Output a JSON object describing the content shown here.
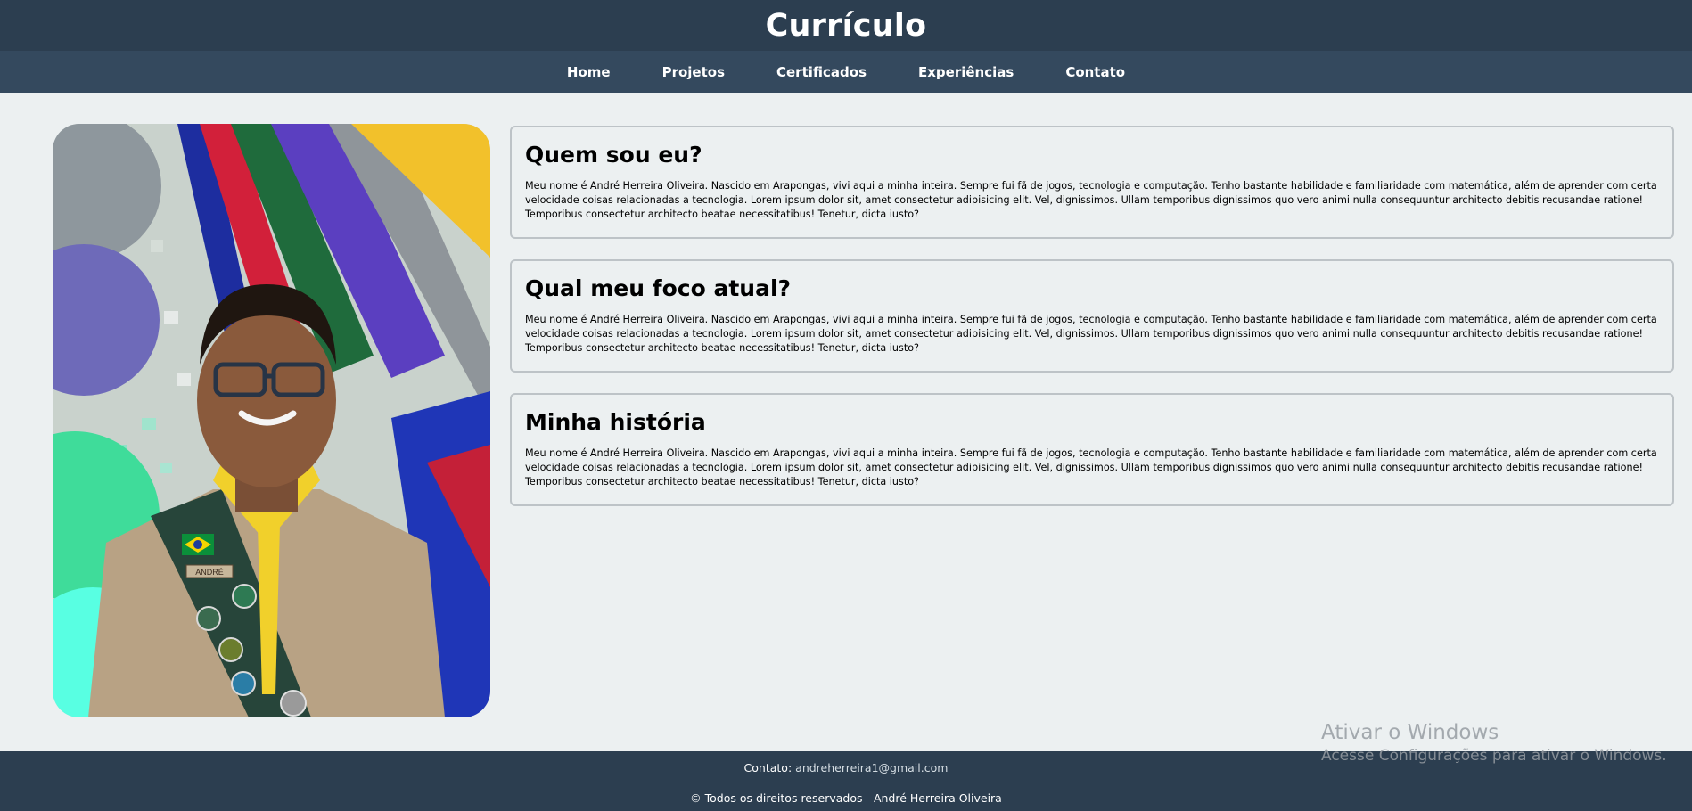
{
  "header": {
    "title": "Currículo"
  },
  "nav": {
    "items": [
      {
        "label": "Home"
      },
      {
        "label": "Projetos"
      },
      {
        "label": "Certificados"
      },
      {
        "label": "Experiências"
      },
      {
        "label": "Contato"
      }
    ]
  },
  "profile_photo": {
    "badge_text": "ANDRÉ"
  },
  "sections": [
    {
      "title": "Quem sou eu?",
      "text": "Meu nome é André Herreira Oliveira. Nascido em Arapongas, vivi aqui a minha inteira. Sempre fui fã de jogos, tecnologia e computação. Tenho bastante habilidade e familiaridade com matemática, além de aprender com certa velocidade coisas relacionadas a tecnologia. Lorem ipsum dolor sit, amet consectetur adipisicing elit. Vel, dignissimos. Ullam temporibus dignissimos quo vero animi nulla consequuntur architecto debitis recusandae ratione! Temporibus consectetur architecto beatae necessitatibus! Tenetur, dicta iusto?"
    },
    {
      "title": "Qual meu foco atual?",
      "text": "Meu nome é André Herreira Oliveira. Nascido em Arapongas, vivi aqui a minha inteira. Sempre fui fã de jogos, tecnologia e computação. Tenho bastante habilidade e familiaridade com matemática, além de aprender com certa velocidade coisas relacionadas a tecnologia. Lorem ipsum dolor sit, amet consectetur adipisicing elit. Vel, dignissimos. Ullam temporibus dignissimos quo vero animi nulla consequuntur architecto debitis recusandae ratione! Temporibus consectetur architecto beatae necessitatibus! Tenetur, dicta iusto?"
    },
    {
      "title": "Minha história",
      "text": "Meu nome é André Herreira Oliveira. Nascido em Arapongas, vivi aqui a minha inteira. Sempre fui fã de jogos, tecnologia e computação. Tenho bastante habilidade e familiaridade com matemática, além de aprender com certa velocidade coisas relacionadas a tecnologia. Lorem ipsum dolor sit, amet consectetur adipisicing elit. Vel, dignissimos. Ullam temporibus dignissimos quo vero animi nulla consequuntur architecto debitis recusandae ratione! Temporibus consectetur architecto beatae necessitatibus! Tenetur, dicta iusto?"
    }
  ],
  "footer": {
    "contact_label": "Contato:",
    "contact_email": "andreherreira1@gmail.com",
    "copyright": "© Todos os direitos reservados - André Herreira Oliveira"
  },
  "watermark": {
    "line1": "Ativar o Windows",
    "line2": "Acesse Configurações para ativar o Windows."
  },
  "colors": {
    "header_bg": "#2c3e50",
    "nav_bg": "#34495e",
    "page_bg": "#ecf0f1",
    "card_border": "#bdc3c7"
  }
}
